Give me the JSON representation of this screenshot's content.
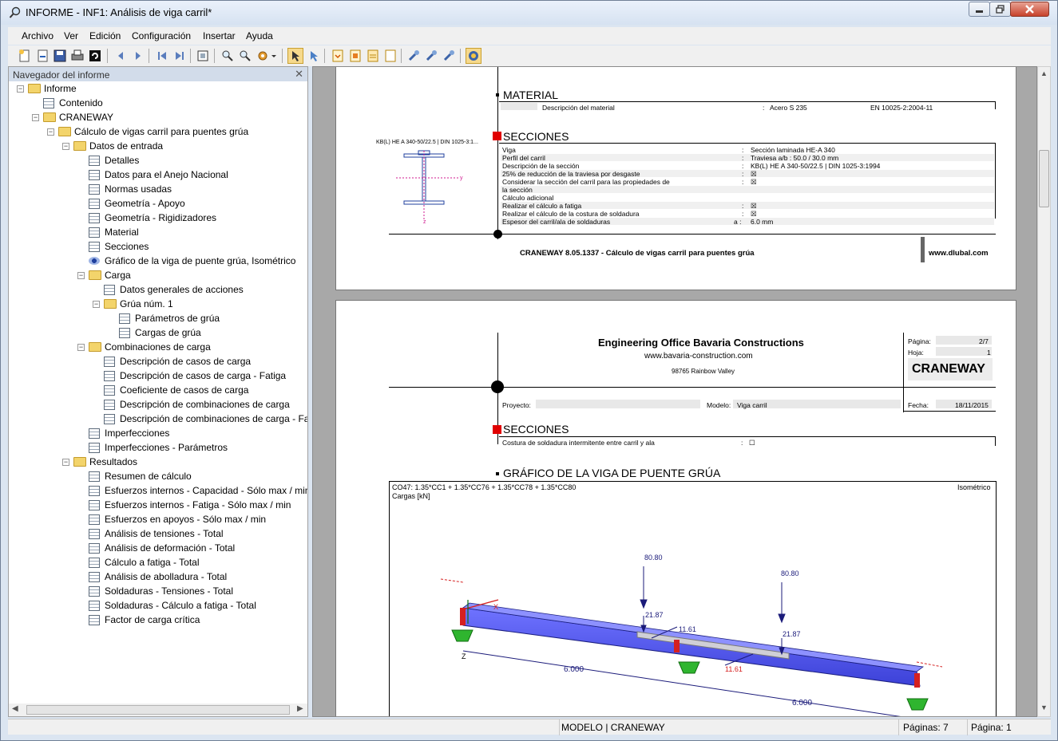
{
  "window": {
    "title": "INFORME - INF1: Análisis de viga carril*"
  },
  "menu": [
    "Archivo",
    "Ver",
    "Edición",
    "Configuración",
    "Insertar",
    "Ayuda"
  ],
  "navigator": {
    "title": "Navegador del informe",
    "items": [
      {
        "label": "Informe",
        "level": 0,
        "icon": "folder",
        "expand": "-"
      },
      {
        "label": "Contenido",
        "level": 1,
        "icon": "table"
      },
      {
        "label": "CRANEWAY",
        "level": 1,
        "icon": "folder",
        "expand": "-"
      },
      {
        "label": "Cálculo de vigas carril para puentes grúa",
        "level": 2,
        "icon": "folder",
        "expand": "-"
      },
      {
        "label": "Datos de entrada",
        "level": 3,
        "icon": "folder",
        "expand": "-"
      },
      {
        "label": "Detalles",
        "level": 4,
        "icon": "table"
      },
      {
        "label": "Datos para el Anejo Nacional",
        "level": 4,
        "icon": "table"
      },
      {
        "label": "Normas usadas",
        "level": 4,
        "icon": "table"
      },
      {
        "label": "Geometría  -  Apoyo",
        "level": 4,
        "icon": "table"
      },
      {
        "label": "Geometría  -  Rigidizadores",
        "level": 4,
        "icon": "table"
      },
      {
        "label": "Material",
        "level": 4,
        "icon": "table"
      },
      {
        "label": "Secciones",
        "level": 4,
        "icon": "table"
      },
      {
        "label": "Gráfico de la viga de puente grúa, Isométrico",
        "level": 4,
        "icon": "eye"
      },
      {
        "label": "Carga",
        "level": 4,
        "icon": "folder",
        "expand": "-"
      },
      {
        "label": "Datos generales de acciones",
        "level": 5,
        "icon": "table"
      },
      {
        "label": "Grúa núm. 1",
        "level": 5,
        "icon": "folder",
        "expand": "-"
      },
      {
        "label": "Parámetros de grúa",
        "level": 6,
        "icon": "table"
      },
      {
        "label": "Cargas de grúa",
        "level": 6,
        "icon": "table"
      },
      {
        "label": "Combinaciones de carga",
        "level": 4,
        "icon": "folder",
        "expand": "-"
      },
      {
        "label": "Descripción de casos de carga",
        "level": 5,
        "icon": "table"
      },
      {
        "label": "Descripción de casos de carga - Fatiga",
        "level": 5,
        "icon": "table"
      },
      {
        "label": "Coeficiente de casos de carga",
        "level": 5,
        "icon": "table"
      },
      {
        "label": "Descripción de combinaciones de carga",
        "level": 5,
        "icon": "table"
      },
      {
        "label": "Descripción de combinaciones de carga - Fat",
        "level": 5,
        "icon": "table"
      },
      {
        "label": "Imperfecciones",
        "level": 4,
        "icon": "table"
      },
      {
        "label": "Imperfecciones  -  Parámetros",
        "level": 4,
        "icon": "table"
      },
      {
        "label": "Resultados",
        "level": 3,
        "icon": "folder",
        "expand": "-"
      },
      {
        "label": "Resumen de cálculo",
        "level": 4,
        "icon": "table"
      },
      {
        "label": "Esfuerzos internos - Capacidad  -  Sólo max / min",
        "level": 4,
        "icon": "table"
      },
      {
        "label": "Esfuerzos internos - Fatiga  -  Sólo max / min",
        "level": 4,
        "icon": "table"
      },
      {
        "label": "Esfuerzos en apoyos  -  Sólo max / min",
        "level": 4,
        "icon": "table"
      },
      {
        "label": "Análisis de tensiones  -  Total",
        "level": 4,
        "icon": "table"
      },
      {
        "label": "Análisis de deformación  -  Total",
        "level": 4,
        "icon": "table"
      },
      {
        "label": "Cálculo a fatiga  -  Total",
        "level": 4,
        "icon": "table"
      },
      {
        "label": "Análisis de abolladura  -  Total",
        "level": 4,
        "icon": "table"
      },
      {
        "label": "Soldaduras - Tensiones  -  Total",
        "level": 4,
        "icon": "table"
      },
      {
        "label": "Soldaduras - Cálculo a fatiga  -  Total",
        "level": 4,
        "icon": "table"
      },
      {
        "label": "Factor de carga crítica",
        "level": 4,
        "icon": "table"
      }
    ]
  },
  "page1": {
    "material_title": "MATERIAL",
    "material_desc_label": "Descripción del material",
    "material_value": "Acero S 235",
    "material_norm": "EN 10025-2:2004-11",
    "secciones_title": "SECCIONES",
    "section_caption": "KB(L) HE A 340-50/22.5 | DIN 1025-3:1...",
    "rows": [
      {
        "label": "Viga",
        "sep": ":",
        "value": "Sección laminada  HE-A 340"
      },
      {
        "label": "Perfil del carril",
        "sep": ":",
        "value": "Traviesa  a/b : 50.0 / 30.0 mm"
      },
      {
        "label": "Descripción de la sección",
        "sep": ":",
        "value": "KB(L) HE A 340-50/22.5 | DIN 1025-3:1994"
      },
      {
        "label": "25% de reducción de la traviesa por desgaste",
        "sep": ":",
        "value": "☒"
      },
      {
        "label": "Considerar la sección del carril para las propiedades de",
        "sep": ":",
        "value": "☒"
      },
      {
        "label": "la sección",
        "sep": "",
        "value": ""
      },
      {
        "label": "Cálculo adicional",
        "sep": "",
        "value": ""
      },
      {
        "label": "Realizar el cálculo a fatiga",
        "sep": ":",
        "value": "☒"
      },
      {
        "label": "Realizar el cálculo de la costura de soldadura",
        "sep": ":",
        "value": "☒"
      },
      {
        "label": "Espesor del carril/ala de soldaduras",
        "sep": "a :",
        "value": "6.0 mm"
      }
    ],
    "footer_left": "CRANEWAY 8.05.1337 - Cálculo de vigas carril para puentes grúa",
    "footer_right": "www.dlubal.com"
  },
  "page2": {
    "company": "Engineering Office Bavaria Constructions",
    "website": "www.bavaria-construction.com",
    "address": "98765 Rainbow Valley",
    "pagina_label": "Página:",
    "pagina_value": "2/7",
    "hoja_label": "Hoja:",
    "hoja_value": "1",
    "module": "CRANEWAY",
    "proyecto_label": "Proyecto:",
    "modelo_label": "Modelo:",
    "modelo_value": "Viga carril",
    "fecha_label": "Fecha:",
    "fecha_value": "18/11/2015",
    "secciones_title": "SECCIONES",
    "costura_label": "Costura de soldadura intermitente entre carril y ala",
    "costura_sep": ":",
    "costura_value": "☐",
    "grafico_title": "GRÁFICO DE LA VIGA DE PUENTE GRÚA",
    "combo": "CO47: 1.35*CC1 + 1.35*CC76 + 1.35*CC78 + 1.35*CC80",
    "cargas_label": "Cargas [kN]",
    "view_label": "Isométrico",
    "load1": "80.80",
    "load2": "80.80",
    "load3": "21.87",
    "load4": "21.87",
    "load5": "11.61",
    "load6": "11.61",
    "dim1": "6.000",
    "dim2": "6.000",
    "axis_x": "X",
    "axis_z": "Z",
    "axis_y": "y",
    "axis_z_small": "z"
  },
  "status": {
    "model": "MODELO | CRANEWAY",
    "pages": "Páginas: 7",
    "page": "Página: 1"
  }
}
